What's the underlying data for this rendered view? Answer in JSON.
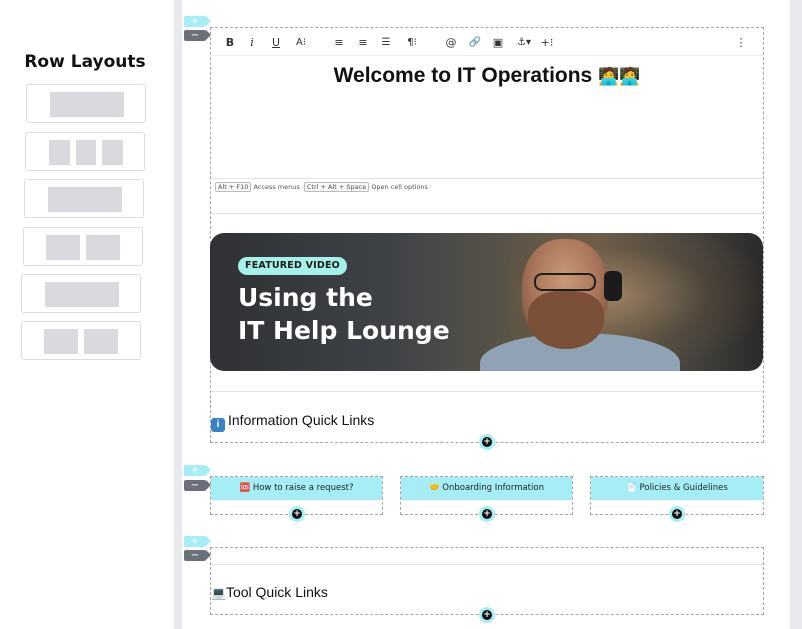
{
  "sidebar": {
    "title": "Row Layouts",
    "layouts": [
      "single-column",
      "three-columns",
      "single-column",
      "two-columns",
      "single-column",
      "two-columns"
    ]
  },
  "toolbar": {
    "bold": "B",
    "italic": "i",
    "underline": "U",
    "font_size": "A⁝",
    "align_left": "≡",
    "align_center": "≡",
    "list": "☰",
    "paragraph": "¶⁝",
    "mention": "@",
    "link": "🔗",
    "image": "▣",
    "anchor": "⚓▾",
    "insert": "+⁝",
    "more": "⋮"
  },
  "hero": {
    "title": "Welcome to IT Operations",
    "emoji": "🧑‍💻🧑‍💻",
    "hint_key1": "Alt + F10",
    "hint_text1": "Access menus",
    "hint_key2": "Ctrl + Alt + Space",
    "hint_text2": "Open cell options"
  },
  "banner": {
    "badge": "FEATURED VIDEO",
    "title_line1": "Using the",
    "title_line2": "IT Help Lounge"
  },
  "sections": {
    "info_title": "Information Quick Links",
    "info_icon": "i",
    "tool_title": "Tool Quick Links",
    "tool_icon": "💻"
  },
  "cells": [
    {
      "icon": "🆘",
      "label": "How to raise a request?"
    },
    {
      "icon": "🤝",
      "label": "Onboarding Information"
    },
    {
      "icon": "📄",
      "label": "Policies & Guidelines"
    }
  ],
  "controls": {
    "plus": "+",
    "minus": "−",
    "add": "+"
  },
  "colors": {
    "accent": "#a5eef5",
    "minus_bg": "#6b6f7a",
    "badge": "#a5f0e8",
    "info_icon_bg": "#3b82c4"
  }
}
